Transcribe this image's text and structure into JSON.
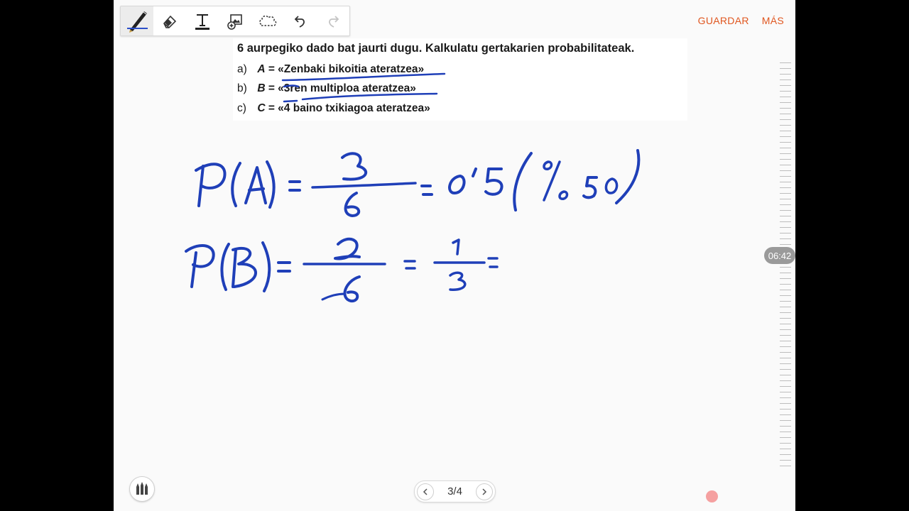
{
  "top_actions": {
    "save_label": "GUARDAR",
    "more_label": "MÁS"
  },
  "colors": {
    "accent": "#e0561f",
    "ink": "#1f3fb8"
  },
  "toolbar": {
    "tools": [
      "pen-icon",
      "eraser-icon",
      "text-icon",
      "image-icon",
      "lasso-icon",
      "undo-icon",
      "redo-icon"
    ]
  },
  "problem": {
    "statement": "6 aurpegiko dado bat jaurti dugu. Kalkulatu gertakarien probabilitateak.",
    "items": [
      {
        "letter": "a)",
        "var": "A",
        "text": "= «Zenbaki bikoitia ateratzea»"
      },
      {
        "letter": "b)",
        "var": "B",
        "text": "= «3ren multiploa ateratzea»"
      },
      {
        "letter": "c)",
        "var": "C",
        "text": "= «4 baino txikiagoa ateratzea»"
      }
    ]
  },
  "handwriting": {
    "line1": "P(A) = 3/6 = 0'5 (%50)",
    "line2": "P(B) = 2/6 = 1/3 ="
  },
  "scroll_time": "06:42",
  "pager": {
    "label": "3/4"
  }
}
